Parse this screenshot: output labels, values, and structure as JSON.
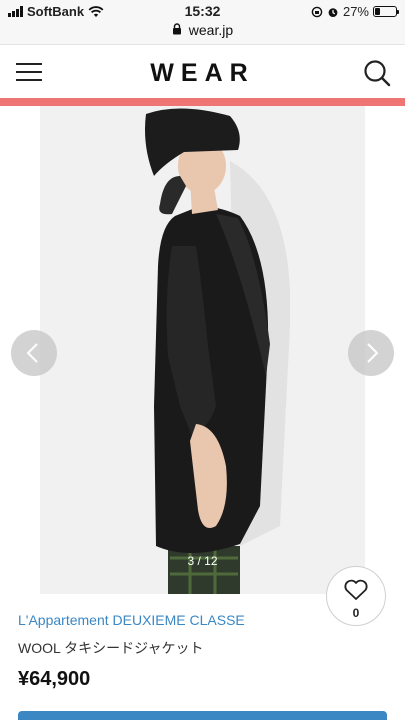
{
  "status_bar": {
    "carrier": "SoftBank",
    "time": "15:32",
    "battery_percent": "27%",
    "battery_level": 0.27
  },
  "browser": {
    "url": "wear.jp"
  },
  "header": {
    "logo": "WEAR",
    "accent_color": "#ef7474"
  },
  "gallery": {
    "counter": "3 / 12"
  },
  "like": {
    "count": "0"
  },
  "product": {
    "brand": "L'Appartement DEUXIEME CLASSE",
    "name": "WOOL タキシードジャケット",
    "price": "¥64,900",
    "brand_color": "#3a87c4"
  }
}
